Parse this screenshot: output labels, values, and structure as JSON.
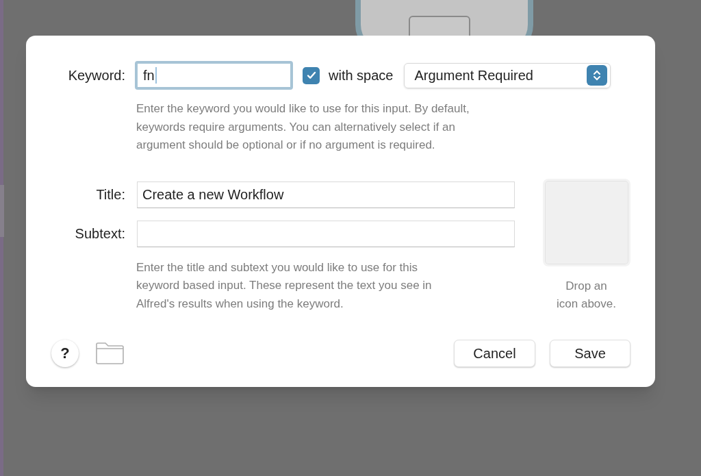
{
  "keyword": {
    "label": "Keyword:",
    "value": "fn",
    "focused": true
  },
  "with_space": {
    "label": "with space",
    "checked": true
  },
  "argument_popup": {
    "value": "Argument Required"
  },
  "keyword_help": "Enter the keyword you would like to use for this input. By default, keywords require arguments. You can alternatively select if an argument should be optional or if no argument is required.",
  "title": {
    "label": "Title:",
    "value": "Create a new Workflow"
  },
  "subtext": {
    "label": "Subtext:"
  },
  "title_help": "Enter the title and subtext you would like to use for this keyword based input. These represent the text you see in Alfred's results when using the keyword.",
  "icon_well": {
    "caption": "Drop an icon above."
  },
  "help_button": "?",
  "buttons": [
    "Cancel",
    "Save"
  ]
}
